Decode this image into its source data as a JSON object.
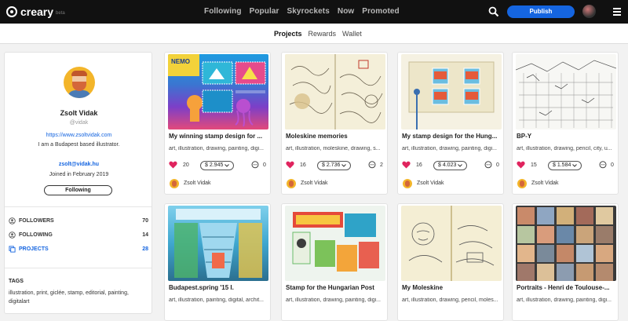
{
  "brand": {
    "name": "creary",
    "tag": "beta"
  },
  "nav": {
    "items": [
      "Following",
      "Popular",
      "Skyrockets",
      "Now",
      "Promoted"
    ]
  },
  "header": {
    "publish_label": "Publish"
  },
  "subnav": {
    "tabs": [
      "Projects",
      "Rewards",
      "Wallet"
    ],
    "active": "Projects"
  },
  "profile": {
    "name": "Zsolt Vidak",
    "username": "@vidak",
    "website": "https://www.zsoltvidak.com",
    "bio": "I am a Budapest based illustrator.",
    "email": "zsolt@vidak.hu",
    "joined": "Joined in February 2019",
    "follow_label": "Following",
    "stats": [
      {
        "label": "FOLLOWERS",
        "value": "70"
      },
      {
        "label": "FOLLOWING",
        "value": "14"
      },
      {
        "label": "PROJECTS",
        "value": "28"
      }
    ],
    "tags_title": "TAGS",
    "tags": "illustration, print, giclée, stamp, editorial, painting, digitalart"
  },
  "projects": [
    {
      "title": "My winning stamp design for ...",
      "tags": "art, illustration, drawing, painting, digi...",
      "likes": "20",
      "price": "$ 2.945",
      "comments": "0",
      "author": "Zsolt Vidak"
    },
    {
      "title": "Moleskine memories",
      "tags": "art, illustration, moleskine, drawing, s...",
      "likes": "16",
      "price": "$ 2.736",
      "comments": "2",
      "author": "Zsolt Vidak"
    },
    {
      "title": "My stamp design for the Hung...",
      "tags": "art, illustration, drawing, painting, digi...",
      "likes": "16",
      "price": "$ 4.023",
      "comments": "0",
      "author": "Zsolt Vidak"
    },
    {
      "title": "BP-Y",
      "tags": "art, illustration, drawing, pencil, city, u...",
      "likes": "15",
      "price": "$ 1.584",
      "comments": "0",
      "author": "Zsolt Vidak"
    },
    {
      "title": "Budapest.spring '15 I.",
      "tags": "art, illustration, painting, digital, archit..."
    },
    {
      "title": "Stamp for the Hungarian Post",
      "tags": "art, illustration, drawing, painting, digi..."
    },
    {
      "title": "My Moleskine",
      "tags": "art, illustration, drawing, pencil, moles..."
    },
    {
      "title": "Portraits - Henri de Toulouse-...",
      "tags": "art, illustration, drawing, painting, digi..."
    }
  ],
  "colors": {
    "accent": "#1565e0",
    "heart": "#e0245e",
    "topbar": "#111111"
  }
}
